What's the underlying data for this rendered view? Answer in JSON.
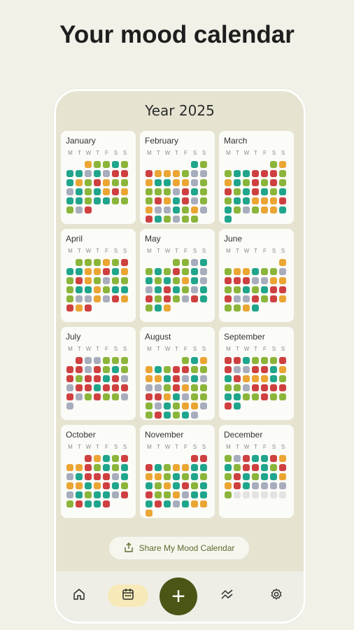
{
  "headline": "Your mood calendar",
  "year_title": "Year 2025",
  "weekdays": [
    "M",
    "T",
    "W",
    "T",
    "F",
    "S",
    "S"
  ],
  "colors": {
    "G": "#8bb53a",
    "T": "#1fa58b",
    "O": "#eba533",
    "R": "#ce4040",
    "S": "#a8adbd",
    "E": "#e3e3e3"
  },
  "months": [
    {
      "name": "January",
      "offset": 2,
      "days": "OGGTGTTSTSRRTOGROGGSTGTOROTTGTTGGGSR"
    },
    {
      "name": "February",
      "offset": 5,
      "days": "TGROOOGSSOTTOOSGGGGSRTGGROTRSGOSSTGOSRTGSGG"
    },
    {
      "name": "March",
      "offset": 5,
      "days": "GOGTTRRRGOTGRGRGRGTRTGTGTTOOORTGSGOOTT"
    },
    {
      "name": "April",
      "offset": 1,
      "days": "GGGOGRTTOORTOGROGSGGGTTOGTTGSSOSROROR"
    },
    {
      "name": "May",
      "offset": 3,
      "days": "GGSTGTGRGTSTGTGOTSSTRTGSTRGRGSRTGTO"
    },
    {
      "name": "June",
      "offset": 6,
      "days": "OGOOTGGSRRRSSOOGGTGTRRRSSRGROGGOT"
    },
    {
      "name": "July",
      "offset": 1,
      "days": "RSSGGGRRSRGTGRGRRTRSSRRTRRRRSGRGGSS"
    },
    {
      "name": "August",
      "offset": 4,
      "days": "GTOOTGRRGGOOTRSTSSSGROGGRROTSGGGSTGOOSGRTGTS"
    },
    {
      "name": "September",
      "offset": 0,
      "days": "RRTGGGRRSSRRTOTROOOTGGGSRRRRTTGGRGGRT"
    },
    {
      "name": "October",
      "offset": 2,
      "days": "ROTGROORGTGTSTRRRSTOOTORTGSTGTTSRGRTTR"
    },
    {
      "name": "November",
      "offset": 5,
      "days": "RRRTGOOTTOOGTGTGTGOTRGTRGGOSTTTRTSTOOO"
    },
    {
      "name": "December",
      "offset": 0,
      "days": "GSRTTROTGRRTGRGRTGTTOORTSSSSGEEEEEE"
    }
  ],
  "share_label": "Share My Mood Calendar",
  "nav": {
    "home": "home-icon",
    "calendar": "calendar-icon",
    "add": "+",
    "stats": "chart-icon",
    "settings": "gear-icon"
  }
}
